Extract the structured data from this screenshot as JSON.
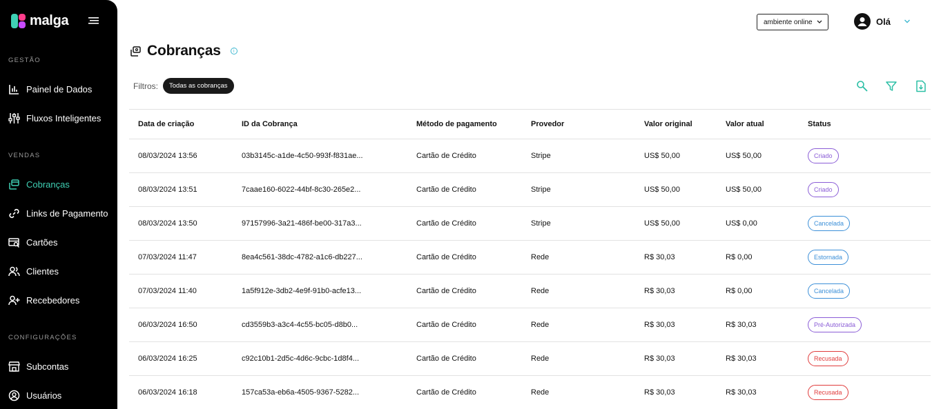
{
  "brand": {
    "name": "malga",
    "accent": "#3fd0b4"
  },
  "sidebar": {
    "sections": [
      {
        "label": "GESTÃO"
      },
      {
        "label": "VENDAS"
      },
      {
        "label": "CONFIGURAÇÕES"
      }
    ],
    "items": [
      {
        "label": "Painel de Dados",
        "icon": "bar-chart-icon"
      },
      {
        "label": "Fluxos Inteligentes",
        "icon": "sliders-icon"
      },
      {
        "label": "Cobranças",
        "icon": "charges-icon",
        "active": true
      },
      {
        "label": "Links de Pagamento",
        "icon": "link-icon"
      },
      {
        "label": "Cartões",
        "icon": "card-search-icon"
      },
      {
        "label": "Clientes",
        "icon": "users-icon"
      },
      {
        "label": "Recebedores",
        "icon": "user-plus-icon"
      },
      {
        "label": "Subcontas",
        "icon": "store-icon"
      },
      {
        "label": "Usuários",
        "icon": "user-circle-icon"
      }
    ]
  },
  "header": {
    "environment": "ambiente online",
    "greeting": "Olá"
  },
  "page": {
    "title": "Cobranças",
    "filters_label": "Filtros:",
    "filter_chip": "Todas as cobranças"
  },
  "table": {
    "columns": [
      "Data de criação",
      "ID da Cobrança",
      "Método de pagamento",
      "Provedor",
      "Valor original",
      "Valor atual",
      "Status"
    ],
    "rows": [
      [
        "08/03/2024 13:56",
        "03b3145c-a1de-4c50-993f-f831ae...",
        "Cartão de Crédito",
        "Stripe",
        "US$ 50,00",
        "US$ 50,00",
        "Criado"
      ],
      [
        "08/03/2024 13:51",
        "7caae160-6022-44bf-8c30-265e2...",
        "Cartão de Crédito",
        "Stripe",
        "US$ 50,00",
        "US$ 50,00",
        "Criado"
      ],
      [
        "08/03/2024 13:50",
        "97157996-3a21-486f-be00-317a3...",
        "Cartão de Crédito",
        "Stripe",
        "US$ 50,00",
        "US$ 0,00",
        "Cancelada"
      ],
      [
        "07/03/2024 11:47",
        "8ea4c561-38dc-4782-a1c6-db227...",
        "Cartão de Crédito",
        "Rede",
        "R$ 30,03",
        "R$ 0,00",
        "Estornada"
      ],
      [
        "07/03/2024 11:40",
        "1a5f912e-3db2-4e9f-91b0-acfe13...",
        "Cartão de Crédito",
        "Rede",
        "R$ 30,03",
        "R$ 0,00",
        "Cancelada"
      ],
      [
        "06/03/2024 16:50",
        "cd3559b3-a3c4-4c55-bc05-d8b0...",
        "Cartão de Crédito",
        "Rede",
        "R$ 30,03",
        "R$ 30,03",
        "Pré-Autorizada"
      ],
      [
        "06/03/2024 16:25",
        "c92c10b1-2d5c-4d6c-9cbc-1d8f4...",
        "Cartão de Crédito",
        "Rede",
        "R$ 30,03",
        "R$ 30,03",
        "Recusada"
      ],
      [
        "06/03/2024 16:18",
        "157ca53a-eb6a-4505-9367-5282...",
        "Cartão de Crédito",
        "Rede",
        "R$ 30,03",
        "R$ 30,03",
        "Recusada"
      ]
    ],
    "status_colors": {
      "Criado": "#8a5cd6",
      "Pré-Autorizada": "#8a5cd6",
      "Cancelada": "#3b8fd8",
      "Estornada": "#3b8fd8",
      "Recusada": "#e03b3b"
    }
  }
}
